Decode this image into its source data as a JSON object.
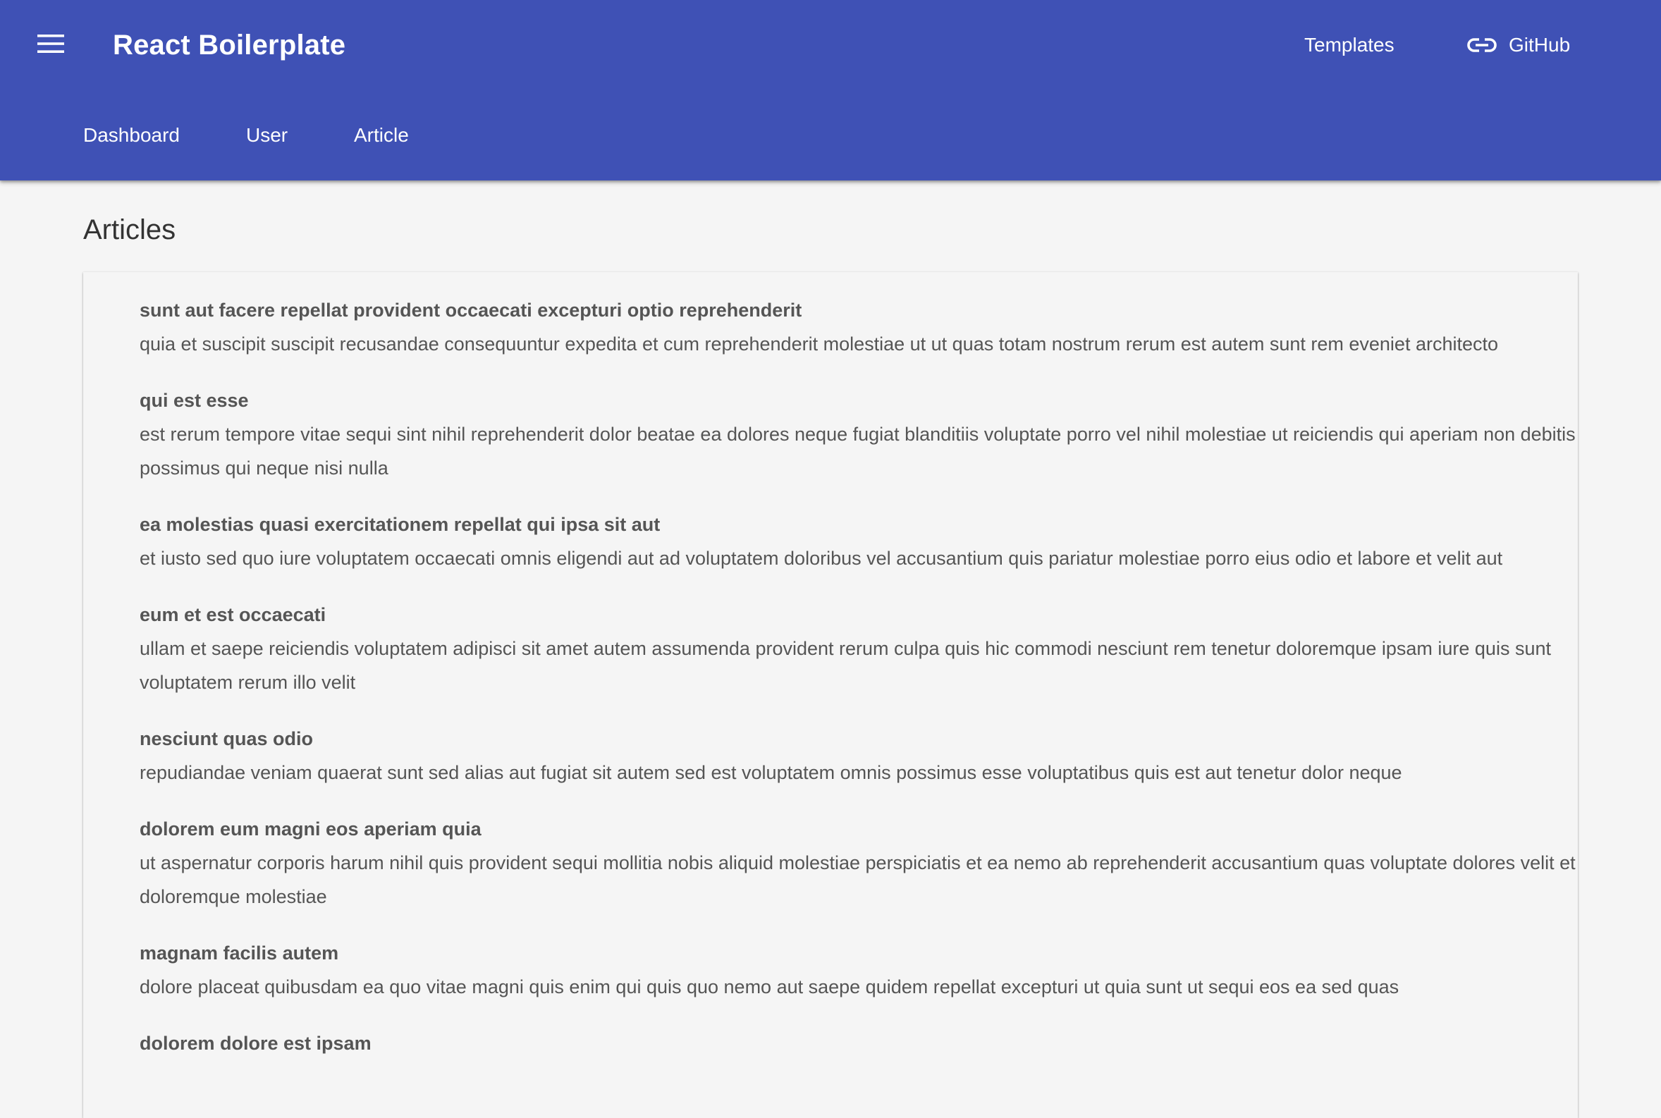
{
  "app_bar": {
    "title": "React Boilerplate",
    "menu_icon": "menu-icon",
    "templates_label": "Templates",
    "github_label": "GitHub",
    "github_icon": "link-icon",
    "bg_color": "#3f51b5"
  },
  "tabs": [
    {
      "label": "Dashboard"
    },
    {
      "label": "User"
    },
    {
      "label": "Article"
    }
  ],
  "page": {
    "title": "Articles"
  },
  "articles": [
    {
      "title": "sunt aut facere repellat provident occaecati excepturi optio reprehenderit",
      "body": "quia et suscipit suscipit recusandae consequuntur expedita et cum reprehenderit molestiae ut ut quas totam nostrum rerum est autem sunt rem eveniet architecto"
    },
    {
      "title": "qui est esse",
      "body": "est rerum tempore vitae sequi sint nihil reprehenderit dolor beatae ea dolores neque fugiat blanditiis voluptate porro vel nihil molestiae ut reiciendis qui aperiam non debitis possimus qui neque nisi nulla"
    },
    {
      "title": "ea molestias quasi exercitationem repellat qui ipsa sit aut",
      "body": "et iusto sed quo iure voluptatem occaecati omnis eligendi aut ad voluptatem doloribus vel accusantium quis pariatur molestiae porro eius odio et labore et velit aut"
    },
    {
      "title": "eum et est occaecati",
      "body": "ullam et saepe reiciendis voluptatem adipisci sit amet autem assumenda provident rerum culpa quis hic commodi nesciunt rem tenetur doloremque ipsam iure quis sunt voluptatem rerum illo velit"
    },
    {
      "title": "nesciunt quas odio",
      "body": "repudiandae veniam quaerat sunt sed alias aut fugiat sit autem sed est voluptatem omnis possimus esse voluptatibus quis est aut tenetur dolor neque"
    },
    {
      "title": "dolorem eum magni eos aperiam quia",
      "body": "ut aspernatur corporis harum nihil quis provident sequi mollitia nobis aliquid molestiae perspiciatis et ea nemo ab reprehenderit accusantium quas voluptate dolores velit et doloremque molestiae"
    },
    {
      "title": "magnam facilis autem",
      "body": "dolore placeat quibusdam ea quo vitae magni quis enim qui quis quo nemo aut saepe quidem repellat excepturi ut quia sunt ut sequi eos ea sed quas"
    },
    {
      "title": "dolorem dolore est ipsam",
      "body": ""
    }
  ]
}
